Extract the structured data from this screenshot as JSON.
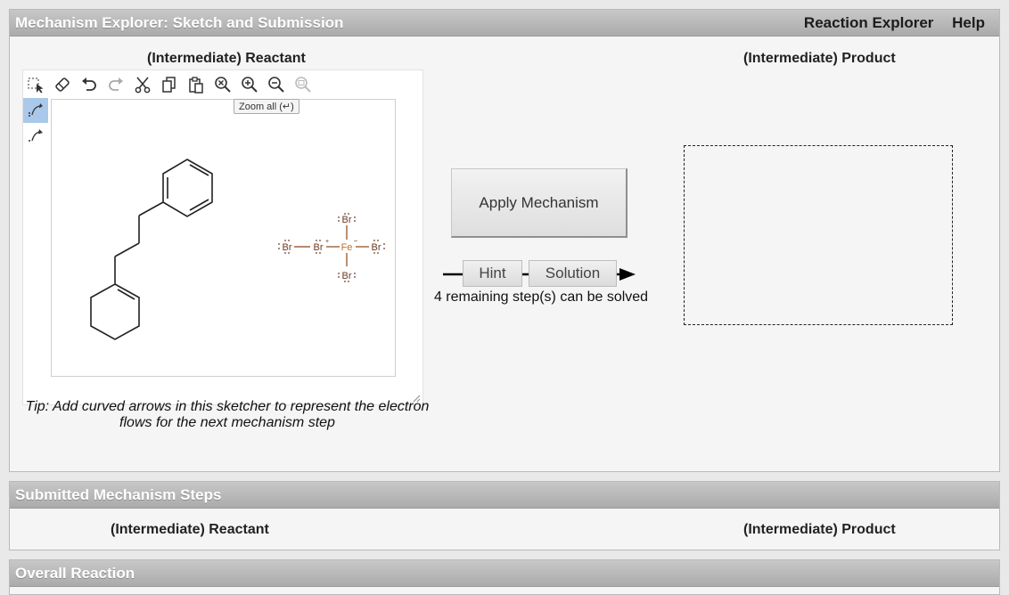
{
  "header": {
    "title": "Mechanism Explorer: Sketch and Submission",
    "links": [
      "Reaction Explorer",
      "Help"
    ]
  },
  "sketch_panel": {
    "reactant_title": "(Intermediate) Reactant",
    "product_title": "(Intermediate) Product",
    "toolbar_icons": [
      "select-icon",
      "eraser-icon",
      "undo-icon",
      "redo-icon",
      "cut-icon",
      "copy-icon",
      "paste-icon",
      "zoom-all-icon",
      "zoom-in-icon",
      "zoom-out-icon",
      "zoom-reset-icon"
    ],
    "side_tools": [
      "curved-arrow-pair-icon",
      "curved-arrow-single-icon"
    ],
    "tooltip": "Zoom all (↵)",
    "molecule_labels": {
      "br": "Br",
      "fe": "Fe",
      "plus": "+",
      "minus": "−"
    },
    "tip": "Tip: Add curved arrows in this sketcher to represent the electron flows for the next mechanism step",
    "apply_button": "Apply Mechanism",
    "hint_button": "Hint",
    "solution_button": "Solution",
    "remaining": "4 remaining step(s) can be solved"
  },
  "submitted": {
    "title": "Submitted Mechanism Steps",
    "reactant_title": "(Intermediate) Reactant",
    "product_title": "(Intermediate) Product"
  },
  "overall": {
    "title": "Overall Reaction"
  },
  "colors": {
    "header_gradient_top": "#c8c8c8",
    "header_gradient_bottom": "#ababab",
    "active_tool": "#aac8ea",
    "atom_brown": "#8b4513"
  }
}
